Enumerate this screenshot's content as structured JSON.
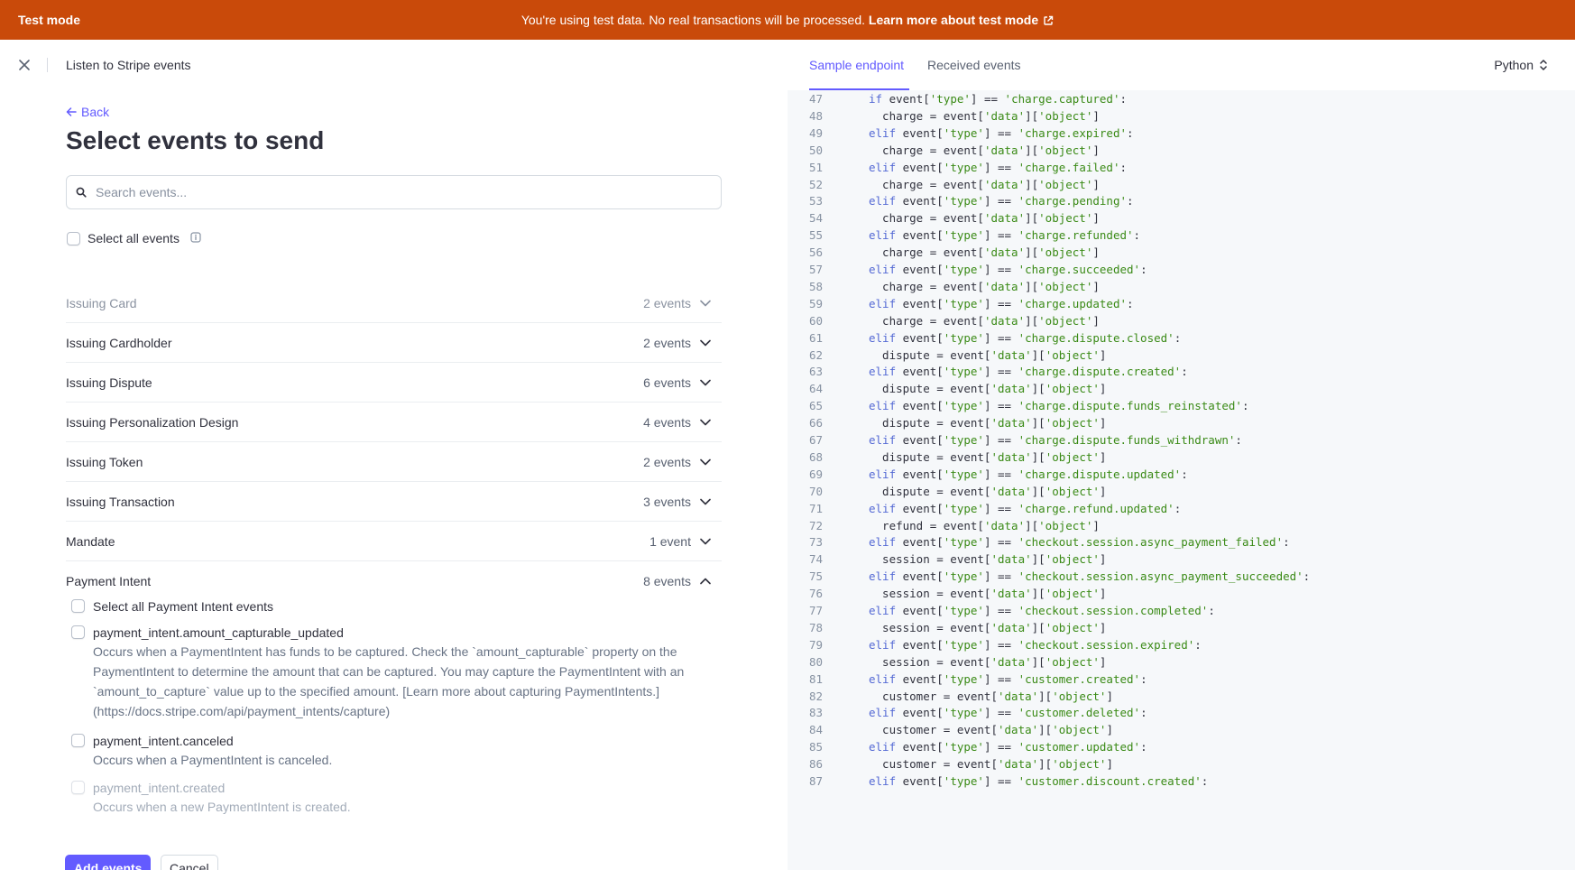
{
  "banner": {
    "mode_label": "Test mode",
    "message": "You're using test data. No real transactions will be processed.",
    "link": "Learn more about test mode",
    "bg_color": "#c94a0a"
  },
  "header": {
    "close_icon": "close-icon",
    "title": "Listen to Stripe events"
  },
  "back_label": "Back",
  "page_title": "Select events to send",
  "search": {
    "placeholder": "Search events..."
  },
  "select_all_label": "Select all events",
  "groups": [
    {
      "name": "Issuing Card",
      "count": "2 events"
    },
    {
      "name": "Issuing Cardholder",
      "count": "2 events"
    },
    {
      "name": "Issuing Dispute",
      "count": "6 events"
    },
    {
      "name": "Issuing Personalization Design",
      "count": "4 events"
    },
    {
      "name": "Issuing Token",
      "count": "2 events"
    },
    {
      "name": "Issuing Transaction",
      "count": "3 events"
    },
    {
      "name": "Mandate",
      "count": "1 event"
    },
    {
      "name": "Payment Intent",
      "count": "8 events"
    }
  ],
  "payment_intent": {
    "select_all_label": "Select all Payment Intent events",
    "events": [
      {
        "name": "payment_intent.amount_capturable_updated",
        "desc_lines": [
          "Occurs when a PaymentIntent has funds to be captured. Check the `amount_capturable` property on the",
          "PaymentIntent to determine the amount that can be captured. You may capture the PaymentIntent with an",
          "`amount_to_capture` value up to the specified amount. [Learn more about capturing PaymentIntents.]",
          "(https://docs.stripe.com/api/payment_intents/capture)"
        ]
      },
      {
        "name": "payment_intent.canceled",
        "desc_lines": [
          "Occurs when a PaymentIntent is canceled."
        ]
      },
      {
        "name": "payment_intent.created",
        "desc_lines": [
          "Occurs when a new PaymentIntent is created."
        ]
      }
    ]
  },
  "footer": {
    "primary": "Add events",
    "secondary": "Cancel"
  },
  "right": {
    "tabs": [
      {
        "label": "Sample endpoint",
        "active": true
      },
      {
        "label": "Received events",
        "active": false
      }
    ],
    "language": "Python",
    "accent": "#635bff",
    "code": [
      {
        "n": "47",
        "kw": "if",
        "event": "charge.captured",
        "var": "charge"
      },
      {
        "n": "49",
        "kw": "elif",
        "event": "charge.expired",
        "var": "charge"
      },
      {
        "n": "51",
        "kw": "elif",
        "event": "charge.failed",
        "var": "charge"
      },
      {
        "n": "53",
        "kw": "elif",
        "event": "charge.pending",
        "var": "charge"
      },
      {
        "n": "55",
        "kw": "elif",
        "event": "charge.refunded",
        "var": "charge"
      },
      {
        "n": "57",
        "kw": "elif",
        "event": "charge.succeeded",
        "var": "charge"
      },
      {
        "n": "59",
        "kw": "elif",
        "event": "charge.updated",
        "var": "charge"
      },
      {
        "n": "61",
        "kw": "elif",
        "event": "charge.dispute.closed",
        "var": "dispute"
      },
      {
        "n": "63",
        "kw": "elif",
        "event": "charge.dispute.created",
        "var": "dispute"
      },
      {
        "n": "65",
        "kw": "elif",
        "event": "charge.dispute.funds_reinstated",
        "var": "dispute"
      },
      {
        "n": "67",
        "kw": "elif",
        "event": "charge.dispute.funds_withdrawn",
        "var": "dispute"
      },
      {
        "n": "69",
        "kw": "elif",
        "event": "charge.dispute.updated",
        "var": "dispute"
      },
      {
        "n": "71",
        "kw": "elif",
        "event": "charge.refund.updated",
        "var": "refund"
      },
      {
        "n": "73",
        "kw": "elif",
        "event": "checkout.session.async_payment_failed",
        "var": "session"
      },
      {
        "n": "75",
        "kw": "elif",
        "event": "checkout.session.async_payment_succeeded",
        "var": "session"
      },
      {
        "n": "77",
        "kw": "elif",
        "event": "checkout.session.completed",
        "var": "session"
      },
      {
        "n": "79",
        "kw": "elif",
        "event": "checkout.session.expired",
        "var": "session"
      },
      {
        "n": "81",
        "kw": "elif",
        "event": "customer.created",
        "var": "customer"
      },
      {
        "n": "83",
        "kw": "elif",
        "event": "customer.deleted",
        "var": "customer"
      },
      {
        "n": "85",
        "kw": "elif",
        "event": "customer.updated",
        "var": "customer"
      },
      {
        "n": "87",
        "kw": "elif",
        "event": "customer.discount.created",
        "var": ""
      }
    ],
    "assign_numbers": [
      "48",
      "50",
      "52",
      "54",
      "56",
      "58",
      "60",
      "62",
      "64",
      "66",
      "68",
      "70",
      "72",
      "74",
      "76",
      "78",
      "80",
      "82",
      "84",
      "86"
    ]
  }
}
